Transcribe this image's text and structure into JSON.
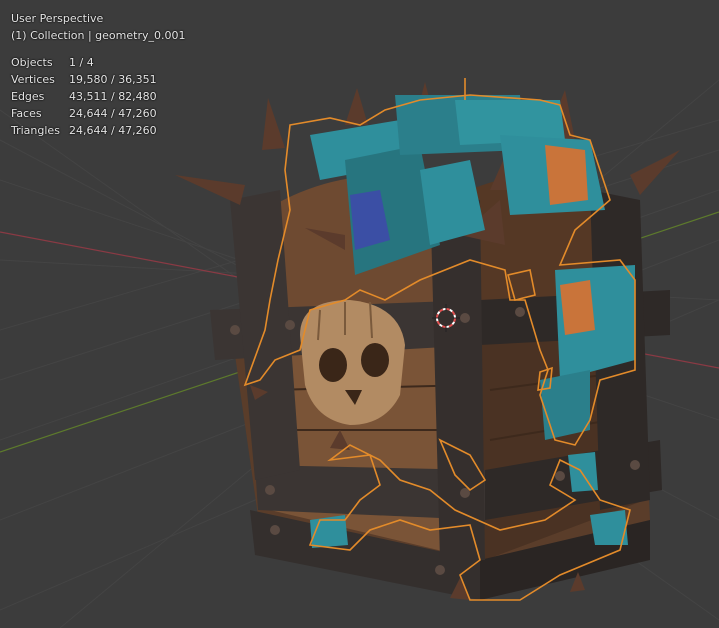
{
  "viewport": {
    "view_name": "User Perspective",
    "collection_line": "(1) Collection | geometry_0.001"
  },
  "stats": [
    {
      "label": "Objects",
      "value": "1 / 4"
    },
    {
      "label": "Vertices",
      "value": "19,580 / 36,351"
    },
    {
      "label": "Edges",
      "value": "43,511 / 82,480"
    },
    {
      "label": "Faces",
      "value": "24,644 / 47,260"
    },
    {
      "label": "Triangles",
      "value": "24,644 / 47,260"
    }
  ],
  "colors": {
    "background": "#3c3c3c",
    "grid": "#454545",
    "x_axis": "#8a3a44",
    "y_axis": "#5d7a2c",
    "selection_outline": "#e38b2a",
    "wood": "#6b4a32",
    "metal": "#3b3533",
    "teal": "#2f8f9c"
  },
  "scene": {
    "object": "treasure-chest-model",
    "selected_parts": "teal-robot-parts",
    "cursor": "3d-cursor"
  }
}
